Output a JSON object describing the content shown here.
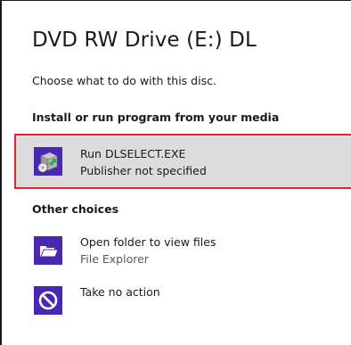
{
  "dialog": {
    "title": "DVD RW Drive (E:) DL",
    "prompt": "Choose what to do with this disc."
  },
  "sections": {
    "install_heading": "Install or run program from your media",
    "other_heading": "Other choices"
  },
  "options": {
    "run": {
      "label": "Run DLSELECT.EXE",
      "sublabel": "Publisher not specified",
      "icon": "setup-program-icon"
    },
    "open_folder": {
      "label": "Open folder to view files",
      "sublabel": "File Explorer",
      "icon": "folder-open-icon"
    },
    "no_action": {
      "label": "Take no action",
      "icon": "no-action-icon"
    }
  },
  "colors": {
    "tile": "#4a27b0",
    "selection_border": "#e0222a",
    "selection_fill": "#dcdcdc"
  }
}
